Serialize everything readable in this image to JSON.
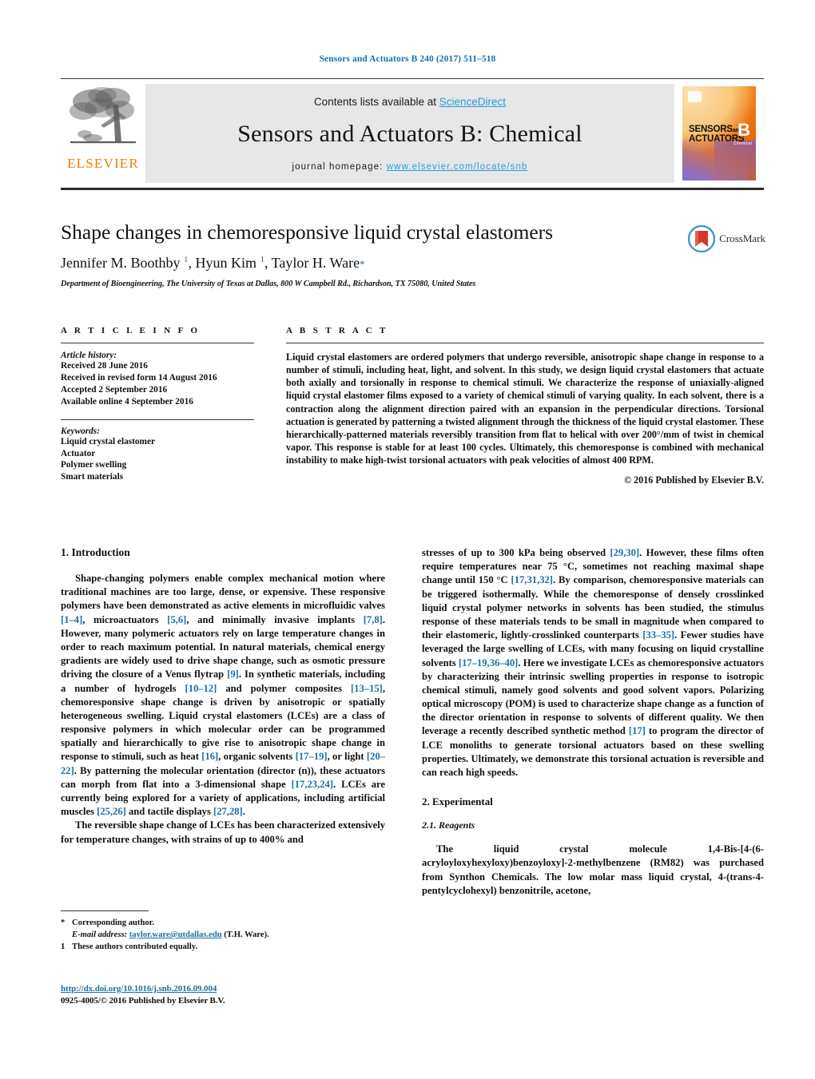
{
  "running_head": "Sensors and Actuators B 240 (2017) 511–518",
  "masthead": {
    "publisher_word": "ELSEVIER",
    "contents_prefix": "Contents lists available at ",
    "contents_link": "ScienceDirect",
    "journal_name": "Sensors and Actuators B: Chemical",
    "homepage_prefix": "journal homepage: ",
    "homepage_url": "www.elsevier.com/locate/snb",
    "cover": {
      "line1": "SENSORS",
      "and": "and",
      "line2": "ACTUATORS",
      "letter": "B",
      "sub": "Chemical"
    }
  },
  "article": {
    "title": "Shape changes in chemoresponsive liquid crystal elastomers",
    "authors_html": "Jennifer M. Boothby <sup>1</sup>, Hyun Kim <sup>1</sup>, Taylor H. Ware<span class=\"star\">*</span>",
    "affiliation": "Department of Bioengineering, The University of Texas at Dallas, 800 W Campbell Rd., Richardson, TX 75080, United States",
    "crossmark_label": "CrossMark"
  },
  "info": {
    "heading": "A R T I C L E   I N F O",
    "history_title": "Article history:",
    "history": [
      "Received 28 June 2016",
      "Received in revised form 14 August 2016",
      "Accepted 2 September 2016",
      "Available online 4 September 2016"
    ],
    "keywords_title": "Keywords:",
    "keywords": [
      "Liquid crystal elastomer",
      "Actuator",
      "Polymer swelling",
      "Smart materials"
    ]
  },
  "abstract": {
    "heading": "A B S T R A C T",
    "text": "Liquid crystal elastomers are ordered polymers that undergo reversible, anisotropic shape change in response to a number of stimuli, including heat, light, and solvent. In this study, we design liquid crystal elastomers that actuate both axially and torsionally in response to chemical stimuli. We characterize the response of uniaxially-aligned liquid crystal elastomer films exposed to a variety of chemical stimuli of varying quality. In each solvent, there is a contraction along the alignment direction paired with an expansion in the perpendicular directions. Torsional actuation is generated by patterning a twisted alignment through the thickness of the liquid crystal elastomer. These hierarchically-patterned materials reversibly transition from flat to helical with over 200°/mm of twist in chemical vapor. This response is stable for at least 100 cycles. Ultimately, this chemoresponse is combined with mechanical instability to make high-twist torsional actuators with peak velocities of almost 400 RPM.",
    "copyright": "© 2016 Published by Elsevier B.V."
  },
  "body": {
    "intro_heading": "1.  Introduction",
    "intro_p1_html": "Shape-changing polymers enable complex mechanical motion where traditional machines are too large, dense, or expensive. These responsive polymers have been demonstrated as active elements in microfluidic valves <span class=\"ref\">[1–4]</span>, microactuators <span class=\"ref\">[5,6]</span>, and minimally invasive implants <span class=\"ref\">[7,8]</span>. However, many polymeric actuators rely on large temperature changes in order to reach maximum potential. In natural materials, chemical energy gradients are widely used to drive shape change, such as osmotic pressure driving the closure of a Venus flytrap <span class=\"ref\">[9]</span>. In synthetic materials, including a number of hydrogels <span class=\"ref\">[10–12]</span> and polymer composites <span class=\"ref\">[13–15]</span>, chemoresponsive shape change is driven by anisotropic or spatially heterogeneous swelling. Liquid crystal elastomers (LCEs) are a class of responsive polymers in which molecular order can be programmed spatially and hierarchically to give rise to anisotropic shape change in response to stimuli, such as heat <span class=\"ref\">[16]</span>, organic solvents <span class=\"ref\">[17–19]</span>, or light <span class=\"ref\">[20–22]</span>. By patterning the molecular orientation (director (n)), these actuators can morph from flat into a 3-dimensional shape <span class=\"ref\">[17,23,24]</span>. LCEs are currently being explored for a variety of applications, including artificial muscles <span class=\"ref\">[25,26]</span> and tactile displays <span class=\"ref\">[27,28]</span>.",
    "intro_p2_html": "The reversible shape change of LCEs has been characterized extensively for temperature changes, with strains of up to 400% and",
    "right_p1_html": "stresses of up to 300 kPa being observed <span class=\"ref\">[29,30]</span>. However, these films often require temperatures near 75 °C, sometimes not reaching maximal shape change until 150 °C <span class=\"ref\">[17,31,32]</span>. By comparison, chemoresponsive materials can be triggered isothermally. While the chemoresponse of densely crosslinked liquid crystal polymer networks in solvents has been studied, the stimulus response of these materials tends to be small in magnitude when compared to their elastomeric, lightly-crosslinked counterparts <span class=\"ref\">[33–35]</span>. Fewer studies have leveraged the large swelling of LCEs, with many focusing on liquid crystalline solvents <span class=\"ref\">[17–19,36–40]</span>. Here we investigate LCEs as chemoresponsive actuators by characterizing their intrinsic swelling properties in response to isotropic chemical stimuli, namely good solvents and good solvent vapors. Polarizing optical microscopy (POM) is used to characterize shape change as a function of the director orientation in response to solvents of different quality. We then leverage a recently described synthetic method <span class=\"ref\">[17]</span> to program the director of LCE monoliths to generate torsional actuators based on these swelling properties. Ultimately, we demonstrate this torsional actuation is reversible and can reach high speeds.",
    "experimental_heading": "2.  Experimental",
    "reagents_heading": "2.1.  Reagents",
    "reagents_p_html": "The liquid crystal molecule 1,4-Bis-[4-(6-acryloyloxyhexyloxy)benzoyloxy]-2-methylbenzene (RM82) was purchased from Synthon Chemicals. The low molar mass liquid crystal, 4-(trans-4-pentylcyclohexyl) benzonitrile, acetone,"
  },
  "footnotes": {
    "corresponding": "Corresponding author.",
    "corresponding_marker": "*",
    "email_label": "E-mail address:",
    "email": "taylor.ware@utdallas.edu",
    "email_suffix": " (T.H. Ware).",
    "equal_marker": "1",
    "equal_contrib": "These authors contributed equally.",
    "doi": "http://dx.doi.org/10.1016/j.snb.2016.09.004",
    "issn": "0925-4005/© 2016 Published by Elsevier B.V."
  },
  "colors": {
    "link": "#1a6fa8",
    "sciencedirect": "#2a9cd6",
    "elsevier_orange": "#ef7d00"
  }
}
